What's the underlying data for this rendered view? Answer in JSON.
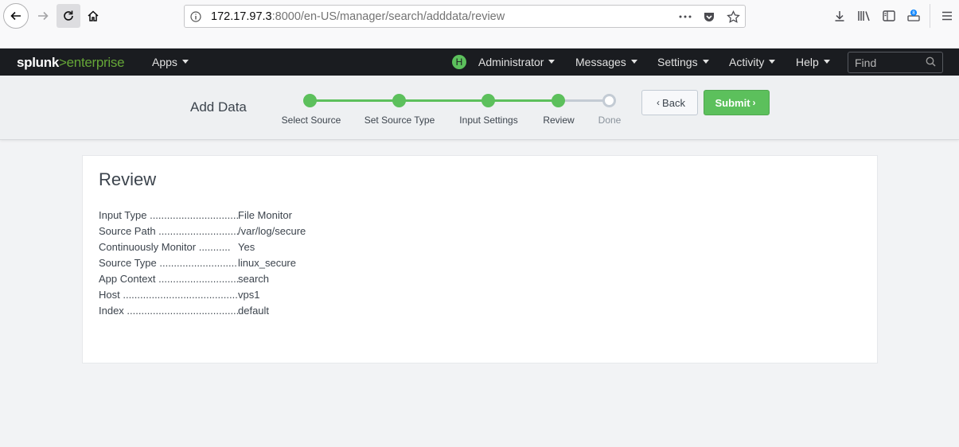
{
  "browser": {
    "url_host": "172.17.97.3",
    "url_path": ":8000/en-US/manager/search/adddata/review",
    "icons": [
      "back-icon",
      "forward-icon",
      "reload-icon",
      "home-icon",
      "info-icon",
      "more-icon",
      "pocket-icon",
      "bookmark-star-icon",
      "download-icon",
      "library-icon",
      "sidebar-icon",
      "sync-icon",
      "menu-icon"
    ]
  },
  "splunk_header": {
    "logo_a": "splunk",
    "logo_b": ">",
    "logo_c": "enterprise",
    "apps_label": "Apps",
    "avatar_letter": "H",
    "user_label": "Administrator",
    "messages_label": "Messages",
    "settings_label": "Settings",
    "activity_label": "Activity",
    "help_label": "Help",
    "find_placeholder": "Find",
    "accent_color": "#65a637"
  },
  "wizard": {
    "title": "Add Data",
    "steps": [
      {
        "label": "Select Source",
        "state": "done"
      },
      {
        "label": "Set Source Type",
        "state": "done"
      },
      {
        "label": "Input Settings",
        "state": "done"
      },
      {
        "label": "Review",
        "state": "current"
      },
      {
        "label": "Done",
        "state": "todo"
      }
    ],
    "back_label": "Back",
    "submit_label": "Submit",
    "submit_color": "#5cc05c"
  },
  "review": {
    "title": "Review",
    "rows": [
      {
        "key": "Input Type ....................................",
        "value": "File Monitor"
      },
      {
        "key": "Source Path ................................",
        "value": "/var/log/secure"
      },
      {
        "key": "Continuously Monitor ...........",
        "value": "Yes"
      },
      {
        "key": "Source Type ...............................",
        "value": "linux_secure"
      },
      {
        "key": "App Context ..............................",
        "value": "search"
      },
      {
        "key": "Host ...............................................",
        "value": "vps1"
      },
      {
        "key": "Index ..............................................",
        "value": "default"
      }
    ]
  }
}
